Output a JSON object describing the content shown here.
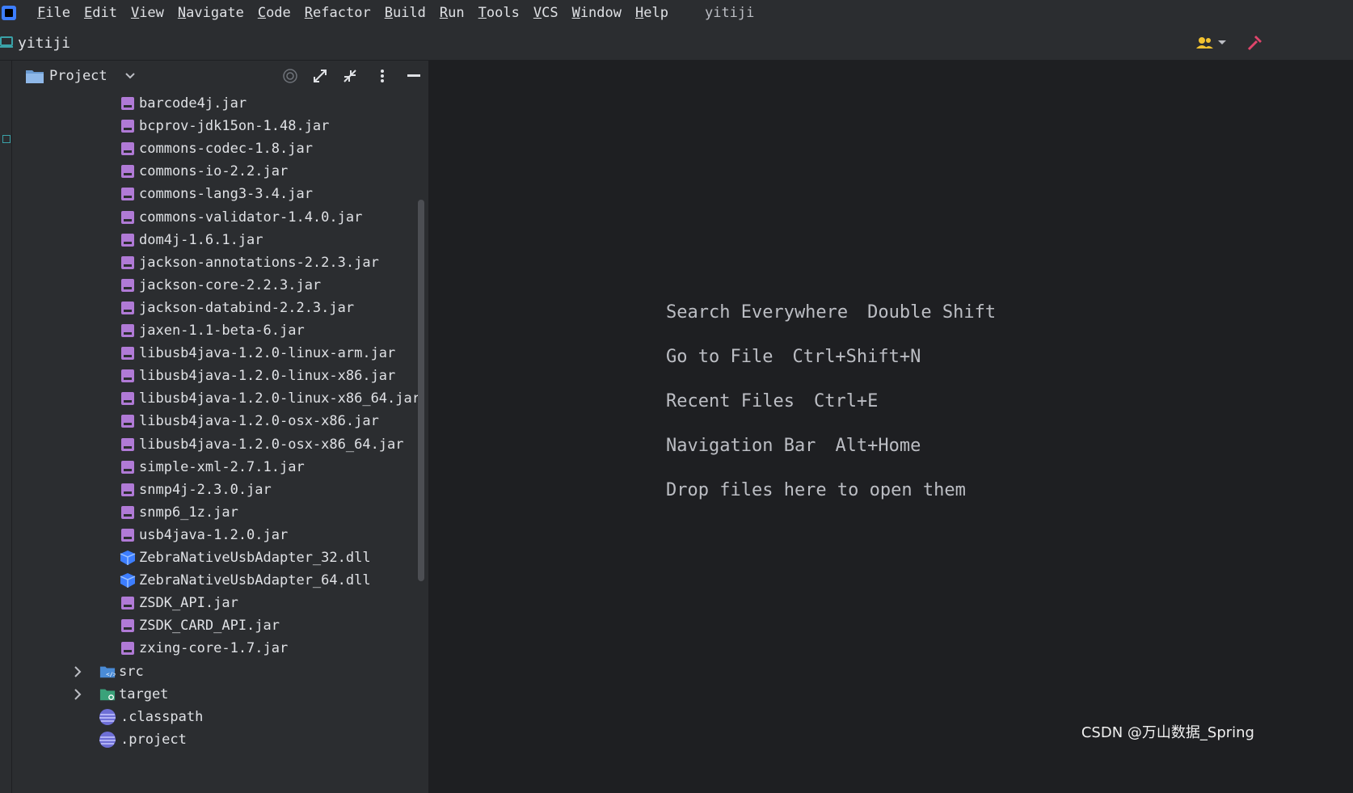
{
  "menubar": {
    "items": [
      "File",
      "Edit",
      "View",
      "Navigate",
      "Code",
      "Refactor",
      "Build",
      "Run",
      "Tools",
      "VCS",
      "Window",
      "Help"
    ],
    "project_title": "yitiji"
  },
  "toolbar": {
    "project_name": "yitiji"
  },
  "panel": {
    "title": "Project"
  },
  "tree": {
    "jars": [
      "barcode4j.jar",
      "bcprov-jdk15on-1.48.jar",
      "commons-codec-1.8.jar",
      "commons-io-2.2.jar",
      "commons-lang3-3.4.jar",
      "commons-validator-1.4.0.jar",
      "dom4j-1.6.1.jar",
      "jackson-annotations-2.2.3.jar",
      "jackson-core-2.2.3.jar",
      "jackson-databind-2.2.3.jar",
      "jaxen-1.1-beta-6.jar",
      "libusb4java-1.2.0-linux-arm.jar",
      "libusb4java-1.2.0-linux-x86.jar",
      "libusb4java-1.2.0-linux-x86_64.jar",
      "libusb4java-1.2.0-osx-x86.jar",
      "libusb4java-1.2.0-osx-x86_64.jar",
      "simple-xml-2.7.1.jar",
      "snmp4j-2.3.0.jar",
      "snmp6_1z.jar",
      "usb4java-1.2.0.jar"
    ],
    "dlls": [
      "ZebraNativeUsbAdapter_32.dll",
      "ZebraNativeUsbAdapter_64.dll"
    ],
    "jars2": [
      "ZSDK_API.jar",
      "ZSDK_CARD_API.jar",
      "zxing-core-1.7.jar"
    ],
    "folders": [
      "src",
      "target"
    ],
    "files": [
      ".classpath",
      ".project"
    ]
  },
  "editor": {
    "hints": [
      {
        "label": "Search Everywhere",
        "key": "Double Shift"
      },
      {
        "label": "Go to File",
        "key": "Ctrl+Shift+N"
      },
      {
        "label": "Recent Files",
        "key": "Ctrl+E"
      },
      {
        "label": "Navigation Bar",
        "key": "Alt+Home"
      },
      {
        "label": "Drop files here to open them",
        "key": ""
      }
    ]
  },
  "watermark": "CSDN @万山数据_Spring",
  "colors": {
    "jar": "#b07ad6",
    "dll": "#3d7eff",
    "folder_src": "#4a8bd6",
    "folder_target": "#3aa27a"
  }
}
